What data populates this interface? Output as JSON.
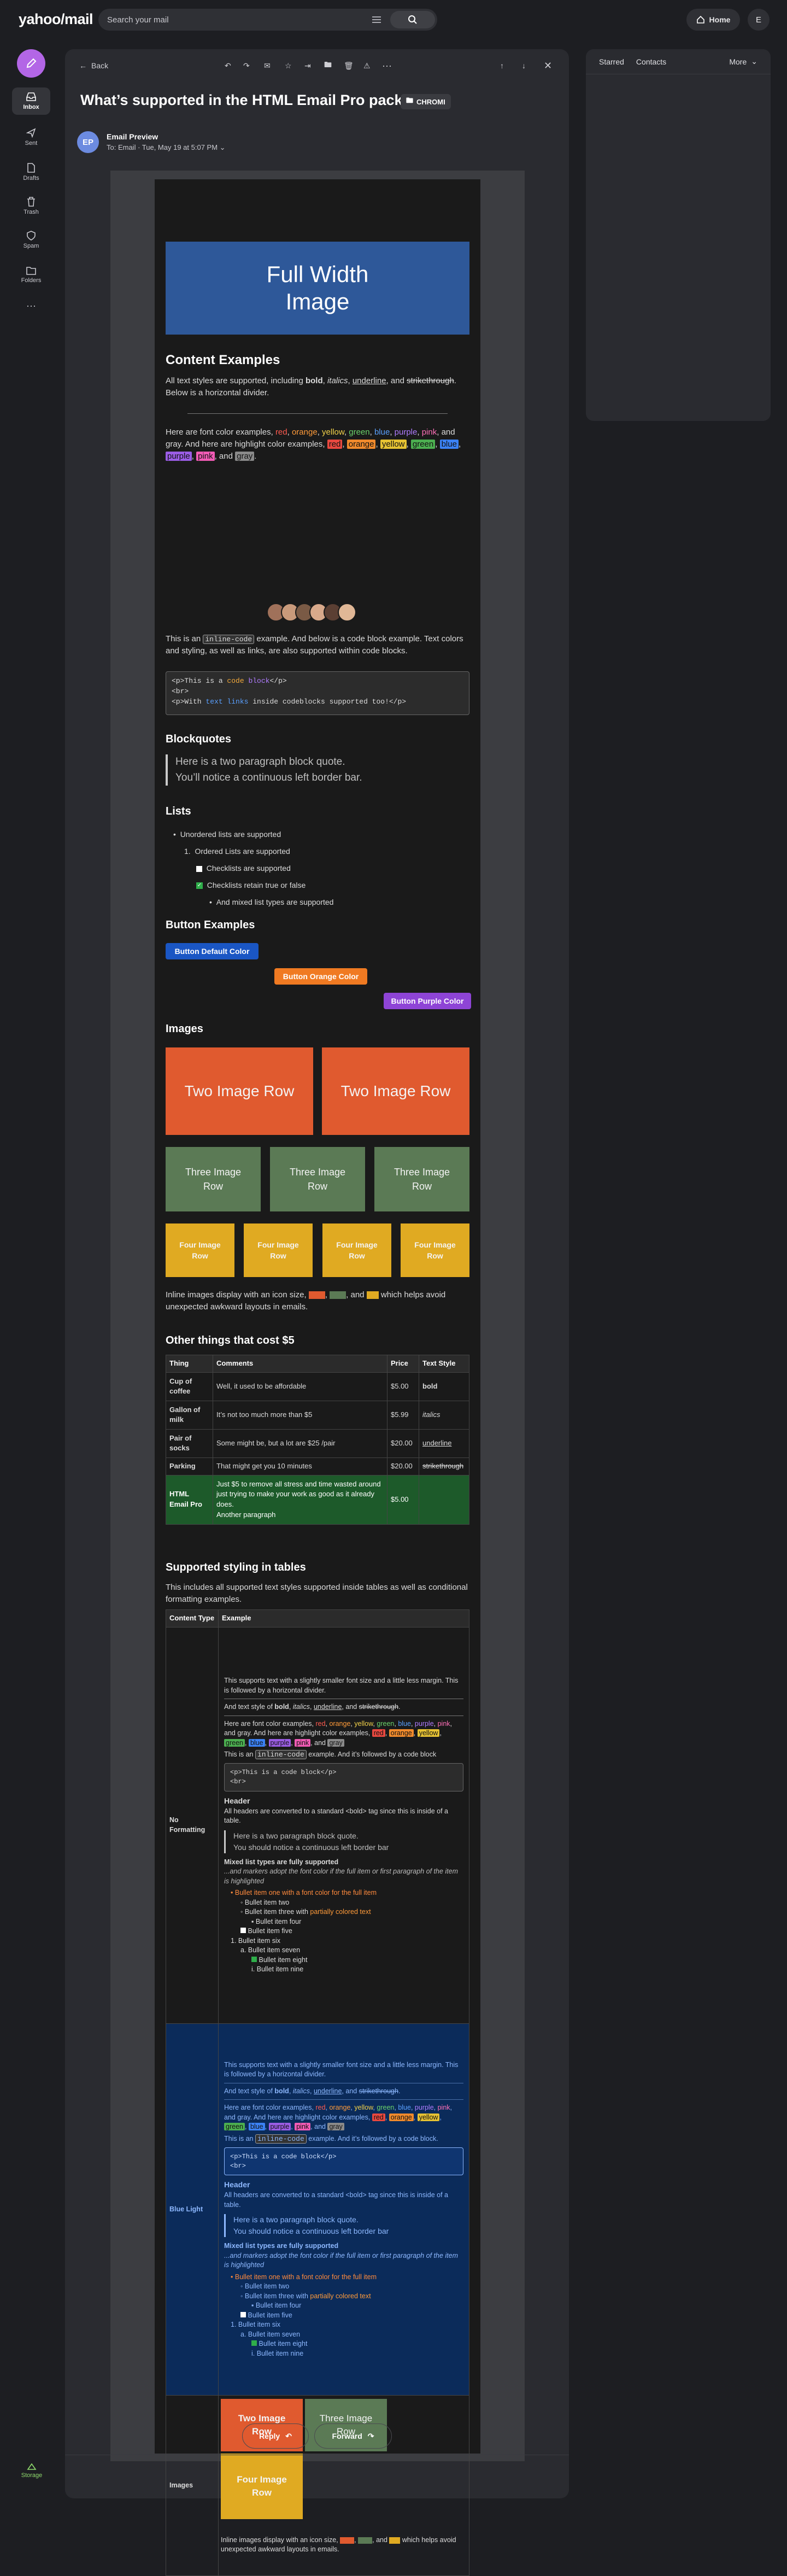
{
  "topbar": {
    "logo": "yahoo/mail",
    "search_placeholder": "Search your mail",
    "home_label": "Home",
    "profile_initial": "E"
  },
  "rail": {
    "items": [
      {
        "label": "Inbox"
      },
      {
        "label": "Sent"
      },
      {
        "label": "Drafts"
      },
      {
        "label": "Trash"
      },
      {
        "label": "Spam"
      },
      {
        "label": "Folders"
      }
    ],
    "storage_label": "Storage"
  },
  "toolbar": {
    "back_label": "Back"
  },
  "message": {
    "subject": "What’s supported in the HTML Email Pro pack",
    "folder_chip": "CHROMI",
    "avatar_initials": "EP",
    "sender": "Email Preview",
    "recipient_line": "To: Email · Tue, May 19 at 5:07 PM",
    "reply_label": "Reply",
    "forward_label": "Forward"
  },
  "right_pane": {
    "starred": "Starred",
    "contacts": "Contacts",
    "more": "More"
  },
  "email": {
    "hero": "Full Width Image",
    "content_title": "Content Examples",
    "content_para_1": "All text styles are supported, including bold, italics, underline, and strikethrough. Below is a horizontal divider.",
    "font_colors_intro": "Here are font color examples,",
    "font_colors": [
      {
        "word": "red",
        "color": "#ff5a4f"
      },
      {
        "word": "orange",
        "color": "#ff9b3a"
      },
      {
        "word": "yellow",
        "color": "#f2d14a"
      },
      {
        "word": "green",
        "color": "#6bd36b"
      },
      {
        "word": "blue",
        "color": "#5aa0ff"
      },
      {
        "word": "purple",
        "color": "#b07cff"
      },
      {
        "word": "pink",
        "color": "#ff6fb8"
      }
    ],
    "highlight_intro": "and gray. And here are highlight color examples,",
    "highlights": [
      {
        "word": "red",
        "color": "#e8483f"
      },
      {
        "word": "orange",
        "color": "#f08a2c"
      },
      {
        "word": "yellow",
        "color": "#e6c233"
      },
      {
        "word": "green",
        "color": "#4caf50"
      },
      {
        "word": "blue",
        "color": "#3b82f6"
      },
      {
        "word": "purple",
        "color": "#9b5de5"
      },
      {
        "word": "pink",
        "color": "#f15bb5"
      },
      {
        "word": "gray",
        "color": "#8a8a8a"
      }
    ],
    "inline_code_sentence_a": "This is an",
    "inline_code_word": "inline-code",
    "inline_code_sentence_b": "example. And below is a code block example. Text colors and styling, as well as links, are also supported within code blocks.",
    "code_lines": [
      "<p>This is a code block</p>",
      "<br>",
      "<p>With text links inside codeblocks supported too!</p>"
    ],
    "blockquotes_title": "Blockquotes",
    "blockquote_line_1": "Here is a two paragraph block quote.",
    "blockquote_line_2": "You’ll notice a continuous left border bar.",
    "lists_title": "Lists",
    "list_items": [
      "Unordered lists are supported",
      "Ordered Lists are supported",
      "Checklists are supported",
      "Checklists retain true or false",
      "And mixed list types are supported"
    ],
    "buttons_title": "Button Examples",
    "btn_default": "Button Default Color",
    "btn_orange": "Button Orange Color",
    "btn_purple": "Button Purple Color",
    "images_title": "Images",
    "two_image": "Two Image Row",
    "three_image": "Three Image Row",
    "four_image": "Four Image Row",
    "inline_images_text_a": "Inline images display with an icon size,",
    "inline_images_text_b": "which helps avoid unexpected awkward layouts in emails.",
    "other_title": "Other things that cost $5",
    "cost_headers": [
      "Thing",
      "Comments",
      "Price",
      "Text Style"
    ],
    "cost_rows": [
      [
        "Cup of coffee",
        "Well, it used to be affordable",
        "$5.00",
        "bold"
      ],
      [
        "Gallon of milk",
        "It’s not too much more than $5",
        "$5.99",
        "italics"
      ],
      [
        "Pair of socks",
        "Some might be, but a lot are $25 /pair",
        "$20.00",
        "underline"
      ],
      [
        "Parking",
        "That might get you 10 minutes",
        "$20.00",
        "strikethrough"
      ]
    ],
    "html_pro_row": {
      "thing": "HTML Email Pro",
      "comment_1": "Just $5 to remove all stress and time wasted around just trying to make your work as good as it already does.",
      "comment_2": "Another paragraph",
      "price": "$5.00"
    },
    "styling_title": "Supported styling in tables",
    "styling_intro": "This includes all supported text styles supported inside tables as well as conditional formatting examples.",
    "styling_headers": [
      "Content Type",
      "Example"
    ],
    "no_formatting_label": "No Formatting",
    "blue_light_label": "Blue Light",
    "images_label": "Images",
    "cell_text_1": "This supports text with a slightly smaller font size and a little less margin. This is followed by a horizontal divider.",
    "cell_text_2": "And text style of bold, italics, underline, and strikethrough.",
    "cell_colors": "Here are font color examples, red, orange, yellow, green, blue, purple, pink, and gray. And here are highlight color examples, red, orange, yellow, green, blue, purple, pink, and gray",
    "cell_code_sentence": "This is an inline-code example. And it’s followed by a code block",
    "cell_code_lines": [
      "<p>This is a code block</p>",
      "<br>"
    ],
    "cell_header": "Header",
    "cell_header_text": "All headers are converted to a standard <bold> tag since this is inside of a table.",
    "cell_bq_1": "Here is a two paragraph block quote.",
    "cell_bq_2": "You should notice a continuous left border bar",
    "cell_mixed_title": "Mixed list types are fully supported",
    "cell_mixed_note": "...and markers adopt the font color if the full item or first paragraph of the item is highlighted",
    "cell_list": [
      "Bullet item one with a font color for the full item",
      "Bullet item two",
      "Bullet item three with partially colored text",
      "Bullet item four",
      "Bullet item five",
      "Bullet item six",
      "Bullet item seven",
      "Bullet item eight",
      "Bullet item nine"
    ],
    "cell_two_image": "Two Image Row",
    "cell_three_image": "Three Image Row",
    "cell_four_image": "Four Image Row",
    "cell_inline_text": "Inline images display with an icon size, , , and which helps avoid unexpected awkward layouts in emails."
  },
  "colors": {
    "accent_compose": "#b366e6",
    "hero_blue": "#2e5899",
    "image_orange": "#e05a2f",
    "image_green": "#5b7a55",
    "image_yellow": "#e0aa22",
    "btn_blue": "#1a56c4",
    "btn_orange": "#f07a22",
    "btn_purple": "#8e44d6",
    "html_pro_green": "#1d5a2a",
    "blue_light_bg": "#0b2b5a"
  }
}
